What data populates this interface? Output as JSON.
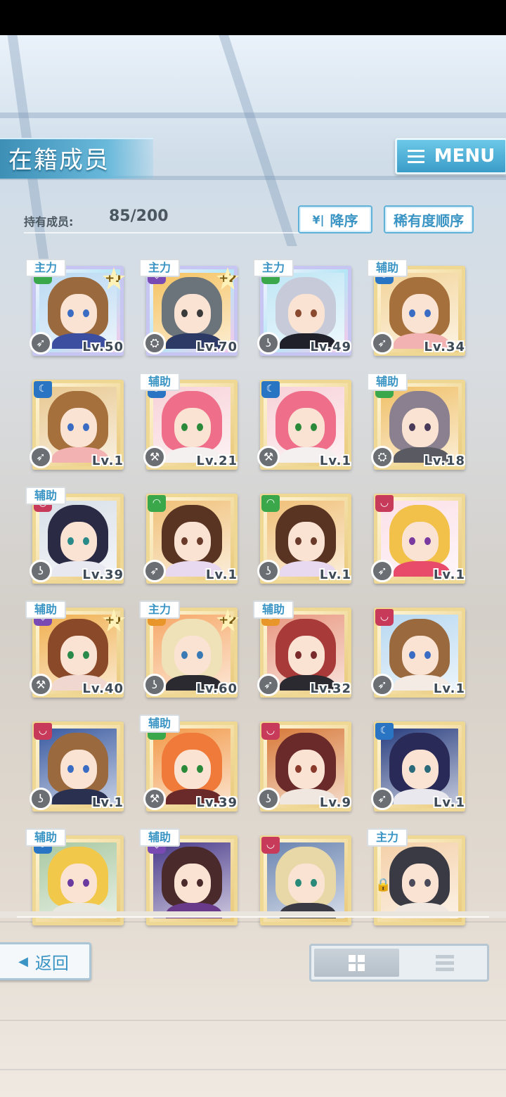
{
  "header": {
    "title": "在籍成员",
    "menu_label": "MENU"
  },
  "owned": {
    "label": "持有成员:",
    "value": "85/200"
  },
  "sort": {
    "order_label": "降序",
    "order_icon": "double-chevron-down-icon",
    "mode_label": "稀有度顺序"
  },
  "colors": {
    "accent": "#3a94c4",
    "frame_gold": "#efd894",
    "frame_rainbow": "#c7c5f2"
  },
  "members": [
    {
      "role": "主力",
      "plus": "+1",
      "level": "Lv.50",
      "frame": "rainbow",
      "attr": "green",
      "type_icon": "arrow-icon",
      "hair": "#9a6a3e",
      "eyes": "#3a6cc4",
      "outfit": "#3c4ea0",
      "bg": "#b9d8f2"
    },
    {
      "role": "主力",
      "plus": "+2",
      "level": "Lv.70",
      "frame": "rainbow",
      "attr": "purple",
      "type_icon": "shield-icon",
      "hair": "#6b747a",
      "eyes": "#3a3a3a",
      "outfit": "#2e3a66",
      "bg": "#f5c261"
    },
    {
      "role": "主力",
      "plus": "",
      "level": "Lv.49",
      "frame": "rainbow",
      "attr": "green",
      "type_icon": "boot-icon",
      "hair": "#c7cbd9",
      "eyes": "#8a4a30",
      "outfit": "#20202a",
      "bg": "#bfe6f5"
    },
    {
      "role": "辅助",
      "plus": "",
      "level": "Lv.34",
      "frame": "gold",
      "attr": "blue",
      "type_icon": "arrow-icon",
      "hair": "#a5703c",
      "eyes": "#3a6cc4",
      "outfit": "#f2b2b2",
      "bg": "#f3d49a"
    },
    {
      "role": "",
      "plus": "",
      "level": "Lv.1",
      "frame": "gold",
      "attr": "blue",
      "type_icon": "arrow-icon",
      "hair": "#a5703c",
      "eyes": "#3a6cc4",
      "outfit": "#f2b2b2",
      "bg": "#e8c890"
    },
    {
      "role": "辅助",
      "plus": "",
      "level": "Lv.21",
      "frame": "gold",
      "attr": "blue",
      "type_icon": "hammer-icon",
      "hair": "#ef6f8a",
      "eyes": "#2a8a3a",
      "outfit": "#f4f0f0",
      "bg": "#f7d2d8"
    },
    {
      "role": "",
      "plus": "",
      "level": "Lv.1",
      "frame": "gold",
      "attr": "blue",
      "type_icon": "hammer-icon",
      "hair": "#ef6f8a",
      "eyes": "#2a8a3a",
      "outfit": "#f4f0f0",
      "bg": "#f7d2d8"
    },
    {
      "role": "辅助",
      "plus": "",
      "level": "Lv.18",
      "frame": "gold",
      "attr": "green",
      "type_icon": "shield-icon",
      "hair": "#8a8090",
      "eyes": "#4a3a5a",
      "outfit": "#5a5a62",
      "bg": "#f0c068"
    },
    {
      "role": "辅助",
      "plus": "",
      "level": "Lv.39",
      "frame": "gold",
      "attr": "red",
      "type_icon": "boot-icon",
      "hair": "#2a2a44",
      "eyes": "#2a8a8a",
      "outfit": "#e8e8f0",
      "bg": "#d8dfe8"
    },
    {
      "role": "",
      "plus": "",
      "level": "Lv.1",
      "frame": "gold",
      "attr": "green",
      "type_icon": "arrow-icon",
      "hair": "#5a3422",
      "eyes": "#6a3a2a",
      "outfit": "#e8d8f0",
      "bg": "#f0c078"
    },
    {
      "role": "",
      "plus": "",
      "level": "Lv.1",
      "frame": "gold",
      "attr": "green",
      "type_icon": "boot-icon",
      "hair": "#5a3422",
      "eyes": "#6a3a2a",
      "outfit": "#e8d8f0",
      "bg": "#f0c078"
    },
    {
      "role": "",
      "plus": "",
      "level": "Lv.1",
      "frame": "gold",
      "attr": "red",
      "type_icon": "arrow-icon",
      "hair": "#f2c14a",
      "eyes": "#7a3aa0",
      "outfit": "#e84a6a",
      "bg": "#fbe0e8"
    },
    {
      "role": "辅助",
      "plus": "+1",
      "level": "Lv.40",
      "frame": "gold",
      "attr": "purple",
      "type_icon": "hammer-icon",
      "hair": "#8a4a2a",
      "eyes": "#2a8a4a",
      "outfit": "#f0d8d0",
      "bg": "#f0b050"
    },
    {
      "role": "主力",
      "plus": "+2",
      "level": "Lv.60",
      "frame": "gold",
      "attr": "orange",
      "type_icon": "boot-icon",
      "hair": "#efe2b8",
      "eyes": "#3a7ab4",
      "outfit": "#2a2a30",
      "bg": "#f6a868"
    },
    {
      "role": "辅助",
      "plus": "",
      "level": "Lv.32",
      "frame": "gold",
      "attr": "orange",
      "type_icon": "arrow-icon",
      "hair": "#a83a3a",
      "eyes": "#7a2a2a",
      "outfit": "#2a2a30",
      "bg": "#e89880"
    },
    {
      "role": "",
      "plus": "",
      "level": "Lv.1",
      "frame": "gold",
      "attr": "red",
      "type_icon": "arrow-icon",
      "hair": "#9a6a3e",
      "eyes": "#3a6cc4",
      "outfit": "#f4ece4",
      "bg": "#b8d8f0"
    },
    {
      "role": "",
      "plus": "",
      "level": "Lv.1",
      "frame": "gold",
      "attr": "red",
      "type_icon": "boot-icon",
      "hair": "#9a6a3e",
      "eyes": "#3a6cc4",
      "outfit": "#2a3050",
      "bg": "#3a5aa0"
    },
    {
      "role": "辅助",
      "plus": "",
      "level": "Lv.39",
      "frame": "gold",
      "attr": "green",
      "type_icon": "hammer-icon",
      "hair": "#ef7a3a",
      "eyes": "#2a8a3a",
      "outfit": "#6a2a2a",
      "bg": "#f29a4a"
    },
    {
      "role": "",
      "plus": "",
      "level": "Lv.9",
      "frame": "gold",
      "attr": "red",
      "type_icon": "boot-icon",
      "hair": "#6a2a2a",
      "eyes": "#8a3a2a",
      "outfit": "#f0e8e0",
      "bg": "#d87a3a"
    },
    {
      "role": "",
      "plus": "",
      "level": "Lv.1",
      "frame": "gold",
      "attr": "blue",
      "type_icon": "arrow-icon",
      "hair": "#2a2a58",
      "eyes": "#2a6a7a",
      "outfit": "#e8e8ee",
      "bg": "#2a3f80"
    },
    {
      "role": "辅助",
      "plus": "",
      "level": "",
      "frame": "gold",
      "attr": "blue",
      "type_icon": "",
      "hair": "#f2c84a",
      "eyes": "#6a3aa0",
      "outfit": "#e8e8e0",
      "bg": "#a8c8a0"
    },
    {
      "role": "辅助",
      "plus": "",
      "level": "",
      "frame": "gold",
      "attr": "purple",
      "type_icon": "",
      "hair": "#4a2a2a",
      "eyes": "#4a2a2a",
      "outfit": "#6a3a8a",
      "bg": "#4a3a8a"
    },
    {
      "role": "",
      "plus": "",
      "level": "",
      "frame": "gold",
      "attr": "red",
      "type_icon": "",
      "hair": "#e8d8a8",
      "eyes": "#2a8a7a",
      "outfit": "#3a3a44",
      "bg": "#6a84b0"
    },
    {
      "role": "主力",
      "plus": "",
      "level": "",
      "frame": "gold",
      "attr": "",
      "type_icon": "",
      "hair": "#3a3a44",
      "eyes": "#4a4a5a",
      "outfit": "#f0e8e0",
      "bg": "#f4d0a8",
      "locked": true
    }
  ],
  "footer": {
    "back_label": "返回",
    "view_grid": "grid-view-icon",
    "view_list": "list-view-icon"
  }
}
